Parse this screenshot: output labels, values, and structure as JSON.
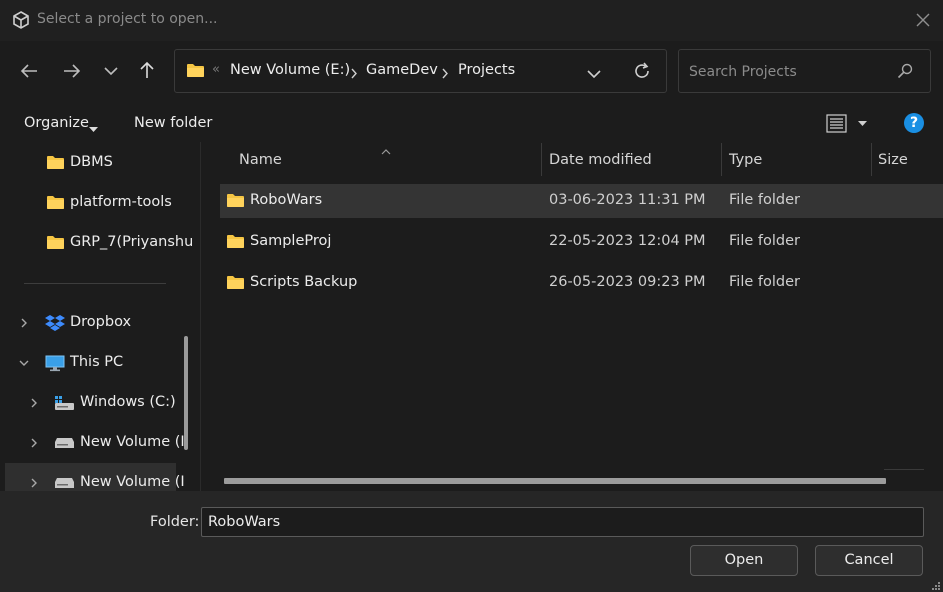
{
  "window": {
    "title": "Select a project to open...",
    "icon": "unity-cube-icon"
  },
  "navigation": {
    "back_icon": "arrow-left-icon",
    "forward_icon": "arrow-right-icon",
    "recent_icon": "chevron-down-icon",
    "up_icon": "arrow-up-icon",
    "breadcrumb": [
      "New Volume (E:)",
      "GameDev",
      "Projects"
    ],
    "overflow_glyph": "«",
    "refresh_icon": "refresh-icon"
  },
  "search": {
    "placeholder": "Search Projects",
    "value": ""
  },
  "toolbar": {
    "organize_label": "Organize",
    "new_folder_label": "New folder",
    "view_icon": "details-view-icon",
    "help_label": "?"
  },
  "nav_pane": {
    "quick_access": [
      {
        "label": "DBMS",
        "icon": "folder-icon"
      },
      {
        "label": "platform-tools",
        "icon": "folder-icon"
      },
      {
        "label": "GRP_7(Priyanshu",
        "icon": "folder-icon"
      }
    ],
    "tree": [
      {
        "label": "Dropbox",
        "icon": "dropbox-icon",
        "expanded": false
      },
      {
        "label": "This PC",
        "icon": "monitor-icon",
        "expanded": true
      },
      {
        "label": "Windows (C:)",
        "icon": "windows-drive-icon",
        "expanded": false
      },
      {
        "label": "New Volume (I",
        "icon": "drive-icon",
        "expanded": false
      },
      {
        "label": "New Volume (I",
        "icon": "drive-icon",
        "expanded": false,
        "selected": true
      }
    ]
  },
  "file_list": {
    "columns": [
      "Name",
      "Date modified",
      "Type",
      "Size"
    ],
    "rows": [
      {
        "name": "RoboWars",
        "date": "03-06-2023 11:31 PM",
        "type": "File folder",
        "selected": true
      },
      {
        "name": "SampleProj",
        "date": "22-05-2023 12:04 PM",
        "type": "File folder"
      },
      {
        "name": "Scripts Backup",
        "date": "26-05-2023 09:23 PM",
        "type": "File folder"
      }
    ]
  },
  "footer": {
    "folder_label": "Folder:",
    "folder_value": "RoboWars",
    "open_label": "Open",
    "cancel_label": "Cancel"
  },
  "colors": {
    "background": "#1c1c1c",
    "footer_bg": "#262626",
    "selected_row": "#343434",
    "folder_yellow": "#f5c543",
    "help_blue": "#1a8fe3"
  }
}
